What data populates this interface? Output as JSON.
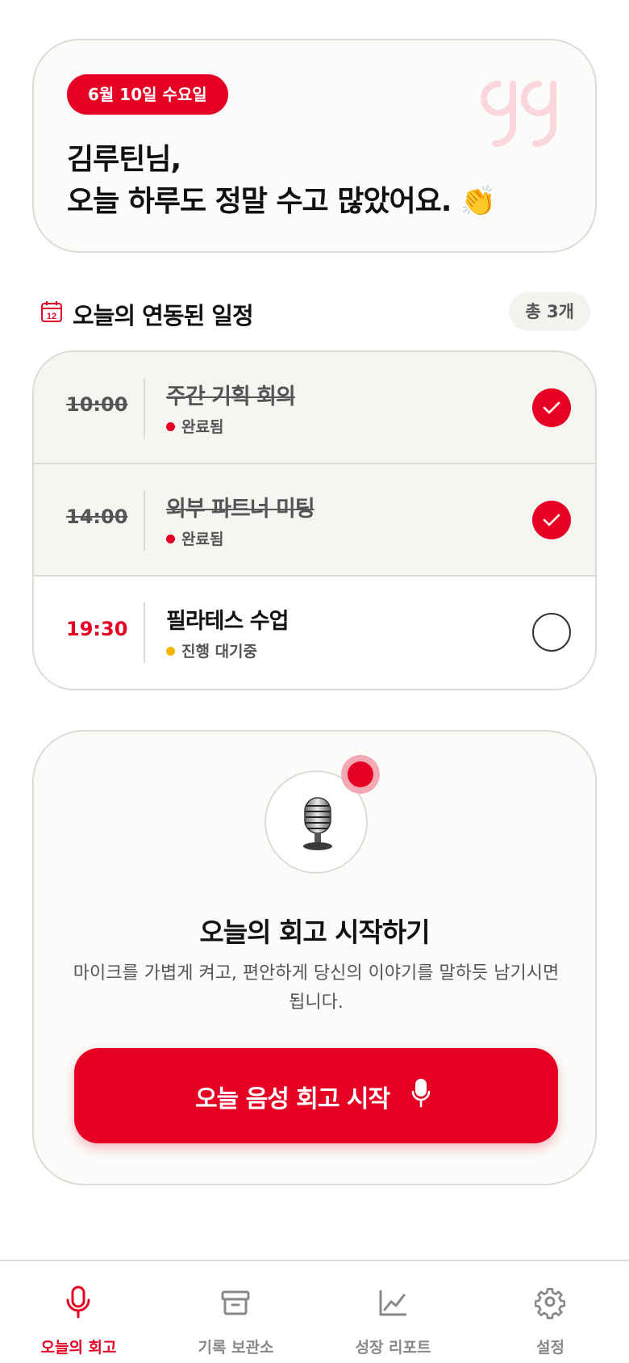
{
  "greeting": {
    "date": "6월 10일 수요일",
    "line1": "김루틴님,",
    "line2": "오늘 하루도 정말 수고 많았어요. 👏"
  },
  "schedule": {
    "title": "오늘의 연동된 일정",
    "count": "총 3개",
    "calendar_day": "12",
    "items": [
      {
        "time": "10:00",
        "title": "주간 기획 회의",
        "status": "완료됨",
        "checked": true
      },
      {
        "time": "14:00",
        "title": "외부 파트너 미팅",
        "status": "완료됨",
        "checked": true
      },
      {
        "time": "19:30",
        "title": "필라테스 수업",
        "status": "진행 대기중",
        "checked": false
      }
    ]
  },
  "voice": {
    "title": "오늘의 회고 시작하기",
    "description": "마이크를 가볍게 켜고, 편안하게 당신의 이야기를 말하듯 남기시면 됩니다.",
    "button_label": "오늘 음성 회고 시작"
  },
  "nav": {
    "items": [
      {
        "label": "오늘의 회고",
        "icon": "mic-icon",
        "active": true
      },
      {
        "label": "기록 보관소",
        "icon": "archive-icon",
        "active": false
      },
      {
        "label": "성장 리포트",
        "icon": "chart-icon",
        "active": false
      },
      {
        "label": "설정",
        "icon": "gear-icon",
        "active": false
      }
    ]
  },
  "colors": {
    "accent": "#e60023",
    "pending": "#f4b400",
    "border": "#dcdcd6"
  }
}
